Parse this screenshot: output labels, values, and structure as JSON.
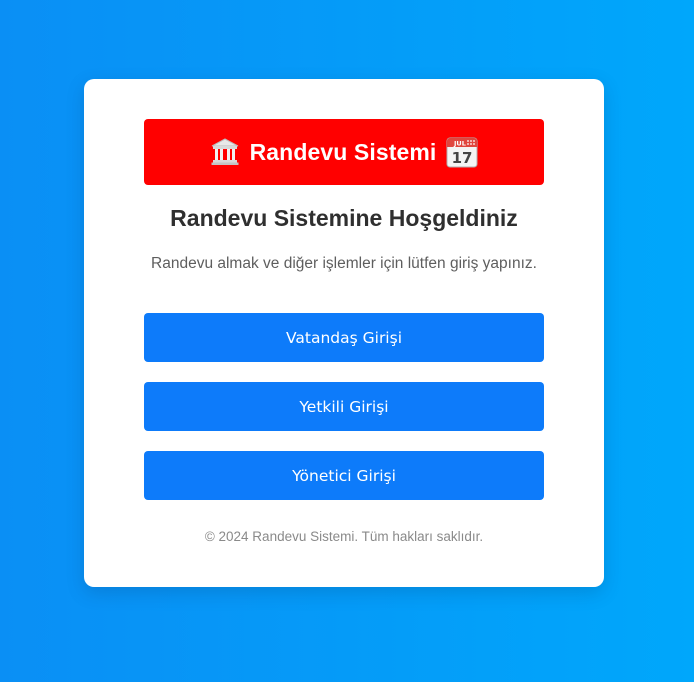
{
  "header": {
    "title": "Randevu Sistemi",
    "bg_color": "#ff0000",
    "left_icon": "bank-building-icon",
    "right_icon": "calendar-icon",
    "calendar_month": "JUL",
    "calendar_day": "17"
  },
  "welcome": {
    "heading": "Randevu Sistemine Hoşgeldiniz",
    "subtext": "Randevu almak ve diğer işlemler için lütfen giriş yapınız."
  },
  "buttons": {
    "citizen_login": "Vatandaş Girişi",
    "authorized_login": "Yetkili Girişi",
    "admin_login": "Yönetici Girişi",
    "color": "#0d7bfa"
  },
  "footer": {
    "text": "© 2024 Randevu Sistemi. Tüm hakları saklıdır."
  }
}
